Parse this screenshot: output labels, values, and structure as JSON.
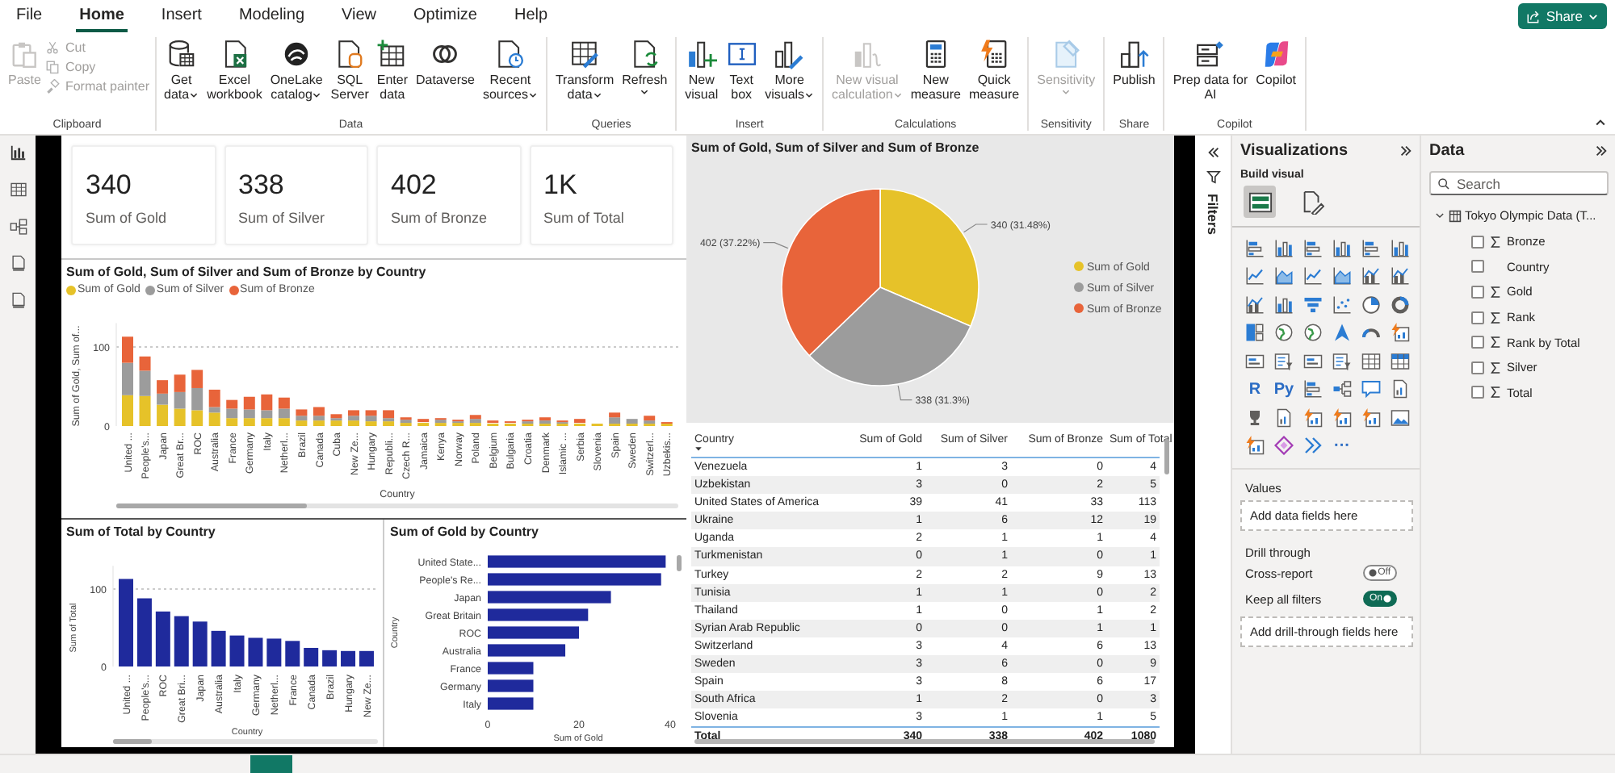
{
  "menu": [
    {
      "label": "File",
      "selected": false
    },
    {
      "label": "Home",
      "selected": true
    },
    {
      "label": "Insert",
      "selected": false
    },
    {
      "label": "Modeling",
      "selected": false
    },
    {
      "label": "View",
      "selected": false
    },
    {
      "label": "Optimize",
      "selected": false
    },
    {
      "label": "Help",
      "selected": false
    }
  ],
  "share_button": {
    "label": "Share",
    "dropdown": true
  },
  "ribbon": [
    {
      "label": "Clipboard",
      "buttons": [
        {
          "kind": "paste",
          "lines": [
            "Paste"
          ],
          "dropdown": false,
          "disabled": true
        }
      ],
      "small_buttons": [
        {
          "kind": "cut",
          "label": "Cut",
          "disabled": true
        },
        {
          "kind": "copy",
          "label": "Copy",
          "disabled": true
        },
        {
          "kind": "brush",
          "label": "Format painter",
          "disabled": true
        }
      ]
    },
    {
      "label": "Data",
      "buttons": [
        {
          "kind": "database",
          "lines": [
            "Get",
            "data"
          ],
          "dropdown": true,
          "disabled": false
        },
        {
          "kind": "excel",
          "lines": [
            "Excel",
            "workbook"
          ],
          "dropdown": false,
          "disabled": false
        },
        {
          "kind": "onelake",
          "lines": [
            "OneLake",
            "catalog"
          ],
          "dropdown": true,
          "disabled": false
        },
        {
          "kind": "sql",
          "lines": [
            "SQL",
            "Server"
          ],
          "dropdown": false,
          "disabled": false
        },
        {
          "kind": "enter",
          "lines": [
            "Enter",
            "data"
          ],
          "dropdown": false,
          "disabled": false
        },
        {
          "kind": "dataverse",
          "lines": [
            "Dataverse"
          ],
          "dropdown": false,
          "disabled": false
        },
        {
          "kind": "recent",
          "lines": [
            "Recent",
            "sources"
          ],
          "dropdown": true,
          "disabled": false
        }
      ]
    },
    {
      "label": "Queries",
      "buttons": [
        {
          "kind": "transform",
          "lines": [
            "Transform",
            "data"
          ],
          "dropdown": true,
          "disabled": false
        },
        {
          "kind": "refresh",
          "lines": [
            "Refresh"
          ],
          "dropdown": true,
          "disabled": false
        }
      ]
    },
    {
      "label": "Insert",
      "buttons": [
        {
          "kind": "newvisual",
          "lines": [
            "New",
            "visual"
          ],
          "dropdown": false,
          "disabled": false
        },
        {
          "kind": "textbox",
          "lines": [
            "Text",
            "box"
          ],
          "dropdown": false,
          "disabled": false
        },
        {
          "kind": "morevisuals",
          "lines": [
            "More",
            "visuals"
          ],
          "dropdown": true,
          "disabled": false
        }
      ]
    },
    {
      "label": "Calculations",
      "buttons": [
        {
          "kind": "viscalc",
          "lines": [
            "New visual",
            "calculation"
          ],
          "dropdown": true,
          "disabled": true
        },
        {
          "kind": "calculator",
          "lines": [
            "New",
            "measure"
          ],
          "dropdown": false,
          "disabled": false
        },
        {
          "kind": "quick",
          "lines": [
            "Quick",
            "measure"
          ],
          "dropdown": false,
          "disabled": false
        }
      ]
    },
    {
      "label": "Sensitivity",
      "buttons": [
        {
          "kind": "sensitivity",
          "lines": [
            "Sensitivity"
          ],
          "dropdown": true,
          "disabled": true
        }
      ]
    },
    {
      "label": "Share",
      "buttons": [
        {
          "kind": "publish",
          "lines": [
            "Publish"
          ],
          "dropdown": false,
          "disabled": false
        }
      ]
    },
    {
      "label": "Copilot",
      "buttons": [
        {
          "kind": "prep",
          "lines": [
            "Prep data for",
            "AI"
          ],
          "dropdown": false,
          "disabled": false
        },
        {
          "kind": "copilot",
          "lines": [
            "Copilot"
          ],
          "dropdown": false,
          "disabled": false
        }
      ]
    }
  ],
  "report": {
    "cards": [
      {
        "value": "340",
        "label": "Sum of Gold"
      },
      {
        "value": "338",
        "label": "Sum of Silver"
      },
      {
        "value": "402",
        "label": "Sum of Bronze"
      },
      {
        "value": "1K",
        "label": "Sum of Total"
      }
    ],
    "stacked_chart": {
      "chart_data": {
        "type": "bar",
        "title": "Sum of Gold, Sum of Silver and Sum of Bronze by Country",
        "xlabel": "Country",
        "ylabel": "Sum of Gold, Sum of...",
        "stacked": true,
        "legend": "top",
        "ylim": [
          0,
          130
        ],
        "yticks": [
          0,
          100
        ],
        "categories": [
          "United ...",
          "People's...",
          "Japan",
          "Great Br...",
          "ROC",
          "Australia",
          "France",
          "Germany",
          "Italy",
          "Netherl...",
          "Brazil",
          "Canada",
          "Cuba",
          "New Ze...",
          "Hungary",
          "Republi...",
          "Czech R...",
          "Jamaica",
          "Kenya",
          "Norway",
          "Poland",
          "Belgium",
          "Bulgaria",
          "Croatia",
          "Denmark",
          "Islamic ...",
          "Serbia",
          "Slovenia",
          "Spain",
          "Sweden",
          "Switzerl...",
          "Uzbekis..."
        ],
        "series": [
          {
            "name": "Sum of Gold",
            "color": "#e6c229",
            "values": [
              39,
              38,
              27,
              22,
              20,
              17,
              10,
              10,
              10,
              10,
              7,
              7,
              7,
              7,
              6,
              6,
              4,
              4,
              4,
              4,
              4,
              3,
              3,
              3,
              3,
              3,
              3,
              3,
              3,
              3,
              3,
              3
            ]
          },
          {
            "name": "Sum of Silver",
            "color": "#9c9c9c",
            "values": [
              41,
              32,
              14,
              21,
              28,
              7,
              12,
              11,
              10,
              12,
              6,
              6,
              3,
              6,
              7,
              4,
              4,
              1,
              4,
              2,
              5,
              1,
              1,
              3,
              4,
              2,
              1,
              1,
              8,
              6,
              4,
              0
            ]
          },
          {
            "name": "Sum of Bronze",
            "color": "#e8643a",
            "values": [
              33,
              18,
              17,
              22,
              23,
              22,
              11,
              16,
              20,
              14,
              8,
              11,
              5,
              7,
              7,
              10,
              3,
              4,
              2,
              2,
              5,
              3,
              2,
              2,
              4,
              2,
              5,
              1,
              6,
              0,
              6,
              2
            ]
          }
        ]
      }
    },
    "total_chart": {
      "chart_data": {
        "type": "bar",
        "title": "Sum of Total by Country",
        "xlabel": "Country",
        "ylim": [
          0,
          130
        ],
        "yticks": [
          0,
          100
        ],
        "categories": [
          "United ...",
          "People's...",
          "ROC",
          "Great Bri...",
          "Japan",
          "Australia",
          "Italy",
          "Germany",
          "Netherl...",
          "France",
          "Canada",
          "Brazil",
          "Hungary",
          "New Ze..."
        ],
        "series": [
          {
            "name": "Sum of Total",
            "color": "#1f2a9c",
            "values": [
              113,
              88,
              71,
              65,
              58,
              46,
              40,
              37,
              36,
              33,
              24,
              21,
              20,
              20
            ]
          }
        ]
      }
    },
    "gold_chart": {
      "chart_data": {
        "type": "bar",
        "orientation": "horizontal",
        "title": "Sum of Gold by Country",
        "ylabel": "Country",
        "xlim": [
          0,
          40
        ],
        "xticks": [
          0,
          20,
          40
        ],
        "categories": [
          "United State...",
          "People's Re...",
          "Japan",
          "Great Britain",
          "ROC",
          "Australia",
          "France",
          "Germany",
          "Italy"
        ],
        "series": [
          {
            "name": "Sum of Gold",
            "color": "#1f2a9c",
            "values": [
              39,
              38,
              27,
              22,
              20,
              17,
              10,
              10,
              10
            ]
          }
        ]
      }
    },
    "pie_chart": {
      "chart_data": {
        "type": "pie",
        "title": "Sum of Gold, Sum of Silver and Sum of Bronze",
        "legend": "right",
        "categories": [
          "Sum of Gold",
          "Sum of Silver",
          "Sum of Bronze"
        ],
        "values": [
          340,
          338,
          402
        ],
        "colors": [
          "#e6c229",
          "#9c9c9c",
          "#e8643a"
        ],
        "value_labels": [
          "340 (31.48%)",
          "338 (31.3%)",
          "402 (37.22%)"
        ]
      }
    },
    "table": {
      "columns": [
        "Country",
        "Sum of Gold",
        "Sum of Silver",
        "Sum of Bronze",
        "Sum of Total"
      ],
      "rows": [
        [
          "Venezuela",
          "1",
          "3",
          "0",
          "4"
        ],
        [
          "Uzbekistan",
          "3",
          "0",
          "2",
          "5"
        ],
        [
          "United States of America",
          "39",
          "41",
          "33",
          "113"
        ],
        [
          "Ukraine",
          "1",
          "6",
          "12",
          "19"
        ],
        [
          "Uganda",
          "2",
          "1",
          "1",
          "4"
        ],
        [
          "Turkmenistan",
          "0",
          "1",
          "0",
          "1"
        ],
        [
          "Turkey",
          "2",
          "2",
          "9",
          "13"
        ],
        [
          "Tunisia",
          "1",
          "1",
          "0",
          "2"
        ],
        [
          "Thailand",
          "1",
          "0",
          "1",
          "2"
        ],
        [
          "Syrian Arab Republic",
          "0",
          "0",
          "1",
          "1"
        ],
        [
          "Switzerland",
          "3",
          "4",
          "6",
          "13"
        ],
        [
          "Sweden",
          "3",
          "6",
          "0",
          "9"
        ],
        [
          "Spain",
          "3",
          "8",
          "6",
          "17"
        ],
        [
          "South Africa",
          "1",
          "2",
          "0",
          "3"
        ],
        [
          "Slovenia",
          "3",
          "1",
          "1",
          "5"
        ]
      ],
      "total": [
        "Total",
        "340",
        "338",
        "402",
        "1080"
      ]
    }
  },
  "filters_pane": {
    "label": "Filters"
  },
  "visualizations": {
    "title": "Visualizations",
    "subtitle": "Build visual",
    "build_tabs": [
      {
        "kind": "fields",
        "selected": true
      },
      {
        "kind": "format",
        "selected": false
      }
    ],
    "visual_types": [
      {
        "kind": "hbar"
      },
      {
        "kind": "vbar"
      },
      {
        "kind": "hbar"
      },
      {
        "kind": "vbar"
      },
      {
        "kind": "hbar"
      },
      {
        "kind": "vbar"
      },
      {
        "kind": "line"
      },
      {
        "kind": "area"
      },
      {
        "kind": "line"
      },
      {
        "kind": "area"
      },
      {
        "kind": "combo"
      },
      {
        "kind": "combo"
      },
      {
        "kind": "combo"
      },
      {
        "kind": "vbar"
      },
      {
        "kind": "funnel"
      },
      {
        "kind": "scatter"
      },
      {
        "kind": "pie"
      },
      {
        "kind": "donut"
      },
      {
        "kind": "treemap"
      },
      {
        "kind": "map"
      },
      {
        "kind": "map"
      },
      {
        "kind": "arrow"
      },
      {
        "kind": "gauge"
      },
      {
        "kind": "bolt"
      },
      {
        "kind": "card"
      },
      {
        "kind": "slicer"
      },
      {
        "kind": "card"
      },
      {
        "kind": "slicer"
      },
      {
        "kind": "grid"
      },
      {
        "kind": "matrix"
      },
      {
        "kind": "label",
        "label": "R"
      },
      {
        "kind": "label",
        "label": "Py"
      },
      {
        "kind": "hbar"
      },
      {
        "kind": "decomp"
      },
      {
        "kind": "chat"
      },
      {
        "kind": "doc"
      },
      {
        "kind": "trophy"
      },
      {
        "kind": "doc"
      },
      {
        "kind": "bolt"
      },
      {
        "kind": "bolt"
      },
      {
        "kind": "bolt"
      },
      {
        "kind": "image"
      },
      {
        "kind": "bolt"
      },
      {
        "kind": "shape"
      },
      {
        "kind": "chevrons"
      },
      {
        "kind": "label",
        "label": "···"
      }
    ],
    "values_label": "Values",
    "values_placeholder": "Add data fields here",
    "drill_label": "Drill through",
    "toggles": [
      {
        "label": "Cross-report",
        "on": false,
        "state_text": "Off"
      },
      {
        "label": "Keep all filters",
        "on": true,
        "state_text": "On"
      }
    ],
    "drill_placeholder": "Add drill-through fields here"
  },
  "data_pane": {
    "title": "Data",
    "search": {
      "placeholder": "Search"
    },
    "tables": [
      {
        "label": "Tokyo Olympic Data (T...",
        "expanded": true,
        "children": [
          {
            "label": "Bronze",
            "kind": "number",
            "checked": false
          },
          {
            "label": "Country",
            "kind": "text",
            "checked": false
          },
          {
            "label": "Gold",
            "kind": "number",
            "checked": false
          },
          {
            "label": "Rank",
            "kind": "number",
            "checked": false
          },
          {
            "label": "Rank by Total",
            "kind": "number",
            "checked": false
          },
          {
            "label": "Silver",
            "kind": "number",
            "checked": false
          },
          {
            "label": "Total",
            "kind": "number",
            "checked": false
          }
        ]
      }
    ]
  }
}
